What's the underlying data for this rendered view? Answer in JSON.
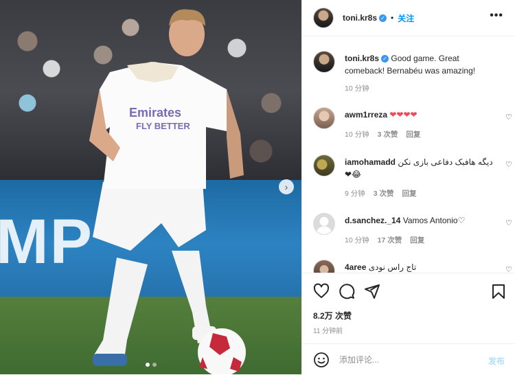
{
  "post": {
    "username": "toni.kr8s",
    "follow_label": "关注",
    "sep": "•",
    "more_label": "•••"
  },
  "media": {
    "board_text": "MP",
    "carousel_total": 2,
    "carousel_active": 1
  },
  "comments": [
    {
      "user": "toni.kr8s",
      "text": "Good game. Great comeback! Bernabéu was amazing!",
      "time": "10 分钟",
      "likes": "",
      "reply": "",
      "verified": true
    },
    {
      "user": "awm1rreza",
      "text": "❤❤❤❤",
      "time": "10 分钟",
      "likes": "3 次赞",
      "reply": "回复"
    },
    {
      "user": "iamohamadd",
      "text": "دیگه هافبک دفاعی بازی نکن😂❤",
      "time": "9 分钟",
      "likes": "3 次赞",
      "reply": "回复"
    },
    {
      "user": "d.sanchez._14",
      "text": "Vamos Antonio♡",
      "time": "10 分钟",
      "likes": "17 次赞",
      "reply": "回复"
    },
    {
      "user": "4aree",
      "text": "تاج راس نودی",
      "time": "",
      "likes": "",
      "reply": ""
    }
  ],
  "stats": {
    "likes": "8.2万 次赞",
    "time": "11 分钟前"
  },
  "composer": {
    "placeholder": "添加评论...",
    "post_label": "发布"
  },
  "icons": {
    "heart": "heart-icon",
    "comment": "comment-icon",
    "share": "share-icon",
    "save": "bookmark-icon",
    "emoji": "emoji-icon"
  },
  "colors": {
    "accent": "#0095f6",
    "verified": "#3897f0",
    "like_red": "#ed4956",
    "muted": "#8e8e8e"
  }
}
